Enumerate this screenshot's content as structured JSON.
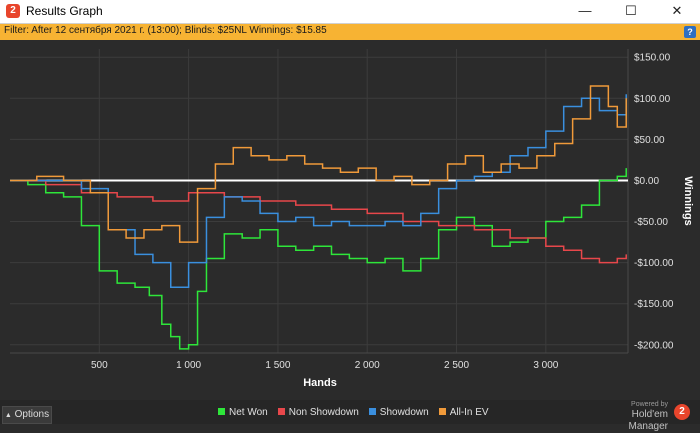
{
  "window": {
    "title": "Results Graph",
    "app_icon_glyph": "2",
    "minimize_glyph": "—",
    "maximize_glyph": "☐",
    "close_glyph": "✕"
  },
  "filter": {
    "text": "Filter: After 12 сентября 2021 г. (13:00); Blinds: $25NL Winnings: $15.85",
    "help_glyph": "?"
  },
  "footer": {
    "options_label": "Options",
    "options_glyph": "▲",
    "brand_powered": "Powered by",
    "brand_name": "Hold'em Manager",
    "brand_logo_glyph": "2"
  },
  "colors": {
    "background": "#2b2b2b",
    "filter_bar": "#f7b333",
    "net_won": "#2ee63a",
    "non_showdown": "#e8474b",
    "showdown": "#3a8fde",
    "all_in_ev": "#f09a3a",
    "zero_line": "#ffffff"
  },
  "chart_data": {
    "type": "line",
    "xlabel": "Hands",
    "ylabel": "Winnings",
    "xlim": [
      0,
      3460
    ],
    "ylim": [
      -210,
      160
    ],
    "x_ticks": [
      500,
      1000,
      1500,
      2000,
      2500,
      3000
    ],
    "x_tick_labels": [
      "500",
      "1 000",
      "1 500",
      "2 000",
      "2 500",
      "3 000"
    ],
    "y_ticks": [
      150,
      100,
      50,
      0,
      -50,
      -100,
      -150,
      -200
    ],
    "y_tick_labels": [
      "$150.00",
      "$100.00",
      "$50.00",
      "$0.00",
      "-$50.00",
      "-$100.00",
      "-$150.00",
      "-$200.00"
    ],
    "grid": true,
    "legend_position": "bottom",
    "series": [
      {
        "name": "Net Won",
        "color": "#2ee63a",
        "x": [
          0,
          100,
          200,
          300,
          400,
          500,
          600,
          700,
          780,
          850,
          900,
          950,
          1000,
          1050,
          1100,
          1200,
          1300,
          1400,
          1500,
          1600,
          1700,
          1800,
          1900,
          2000,
          2100,
          2200,
          2300,
          2400,
          2500,
          2600,
          2700,
          2800,
          2900,
          3000,
          3100,
          3200,
          3300,
          3400,
          3450
        ],
        "y": [
          0,
          -5,
          -15,
          -20,
          -55,
          -110,
          -125,
          -130,
          -140,
          -175,
          -190,
          -205,
          -200,
          -135,
          -95,
          -65,
          -70,
          -60,
          -80,
          -85,
          -80,
          -90,
          -95,
          -100,
          -95,
          -110,
          -95,
          -60,
          -45,
          -55,
          -80,
          -75,
          -70,
          -50,
          -45,
          -30,
          0,
          5,
          15
        ]
      },
      {
        "name": "Non Showdown",
        "color": "#e8474b",
        "x": [
          0,
          200,
          400,
          600,
          800,
          1000,
          1200,
          1400,
          1600,
          1800,
          2000,
          2200,
          2400,
          2600,
          2800,
          3000,
          3100,
          3200,
          3300,
          3400,
          3450
        ],
        "y": [
          0,
          -5,
          -15,
          -20,
          -25,
          -15,
          -20,
          -25,
          -30,
          -35,
          -40,
          -50,
          -55,
          -60,
          -70,
          -80,
          -85,
          -95,
          -100,
          -95,
          -90
        ]
      },
      {
        "name": "Showdown",
        "color": "#3a8fde",
        "x": [
          0,
          200,
          400,
          550,
          700,
          800,
          900,
          1000,
          1100,
          1200,
          1300,
          1400,
          1500,
          1600,
          1700,
          1800,
          1900,
          2000,
          2100,
          2200,
          2300,
          2400,
          2500,
          2600,
          2700,
          2800,
          2900,
          3000,
          3100,
          3200,
          3300,
          3400,
          3450
        ],
        "y": [
          0,
          0,
          -10,
          -60,
          -90,
          -100,
          -130,
          -100,
          -45,
          -20,
          -25,
          -40,
          -50,
          -45,
          -55,
          -50,
          -55,
          -55,
          -50,
          -55,
          -40,
          -10,
          0,
          5,
          10,
          30,
          40,
          60,
          90,
          100,
          85,
          80,
          105
        ]
      },
      {
        "name": "All-In EV",
        "color": "#f09a3a",
        "x": [
          0,
          150,
          300,
          450,
          550,
          650,
          750,
          850,
          950,
          1050,
          1150,
          1250,
          1350,
          1450,
          1550,
          1650,
          1750,
          1850,
          1950,
          2050,
          2150,
          2250,
          2350,
          2450,
          2550,
          2650,
          2750,
          2850,
          2950,
          3050,
          3150,
          3250,
          3350,
          3400,
          3450
        ],
        "y": [
          0,
          5,
          0,
          -15,
          -60,
          -70,
          -60,
          -55,
          -75,
          -10,
          20,
          40,
          30,
          25,
          30,
          20,
          15,
          10,
          15,
          0,
          5,
          -5,
          0,
          20,
          30,
          10,
          20,
          15,
          30,
          45,
          75,
          115,
          90,
          65,
          100
        ]
      }
    ]
  }
}
